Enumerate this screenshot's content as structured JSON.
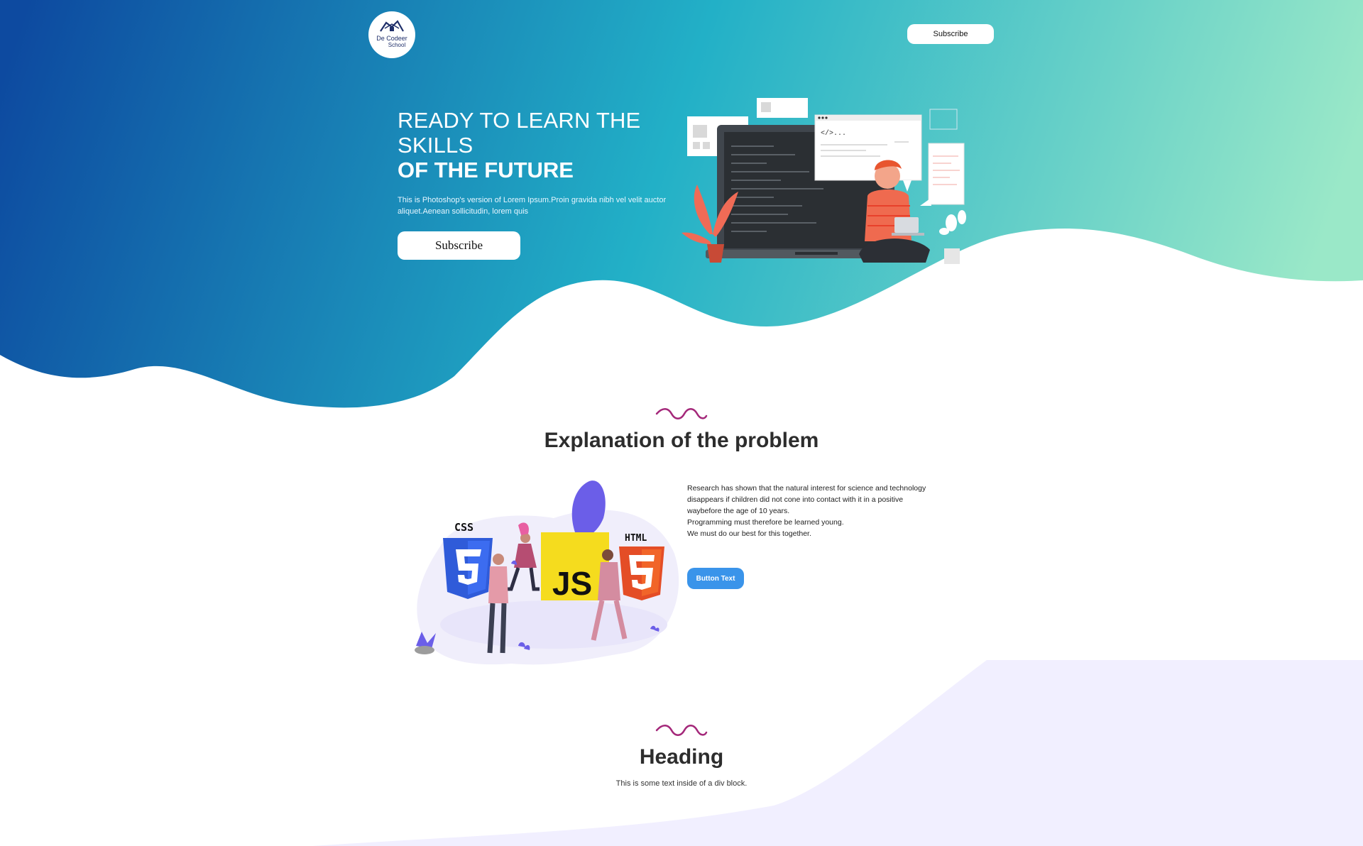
{
  "header": {
    "logo_line1": "De Codeer",
    "logo_line2": "School",
    "subscribe_label": "Subscribe"
  },
  "hero": {
    "title_line1": "READY TO LEARN THE",
    "title_line2": "SKILLS",
    "title_line3": "OF THE FUTURE",
    "description": "This is Photoshop's version of Lorem Ipsum.Proin gravida nibh vel velit auctor aliquet.Aenean sollicitudin, lorem quis",
    "subscribe_label": "Subscribe",
    "code_tag": "</>...",
    "colors": {
      "gradient_start": "#0d4aa0",
      "gradient_mid": "#22b0c7",
      "gradient_end": "#9ae8c8"
    }
  },
  "problem": {
    "title": "Explanation of the problem",
    "paragraph_lines": [
      "Research has shown that the natural interest for science and technology",
      "disappears if children did not cone into contact with it in a positive",
      "waybefore the age of 10 years.",
      "Programming must therefore be learned young.",
      "We must do our best for this together."
    ],
    "button_label": "Button Text",
    "badge_css": "CSS",
    "badge_js": "JS",
    "badge_html": "HTML",
    "accent_color": "#a4287a",
    "button_color": "#3a94ea"
  },
  "section2": {
    "title": "Heading",
    "text": "This is some text inside of a div block.",
    "background_color": "#f1efff"
  }
}
